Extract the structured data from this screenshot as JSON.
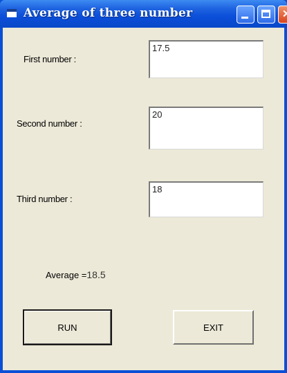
{
  "window": {
    "title": "Average of three number",
    "icons": {
      "app": "app-icon",
      "minimize": "minimize-icon",
      "maximize": "maximize-icon",
      "close": "close-icon"
    },
    "colors": {
      "titlebar": "#0b4ed8",
      "client": "#ece9d8",
      "close_button": "#d9431c"
    }
  },
  "form": {
    "first_label": "First number :",
    "first_value": "17.5",
    "second_label": "Second number :",
    "second_value": "20",
    "third_label": "Third number :",
    "third_value": "18",
    "average_label": "Average =",
    "average_value": "18.5"
  },
  "buttons": {
    "run": "RUN",
    "exit": "EXIT"
  }
}
